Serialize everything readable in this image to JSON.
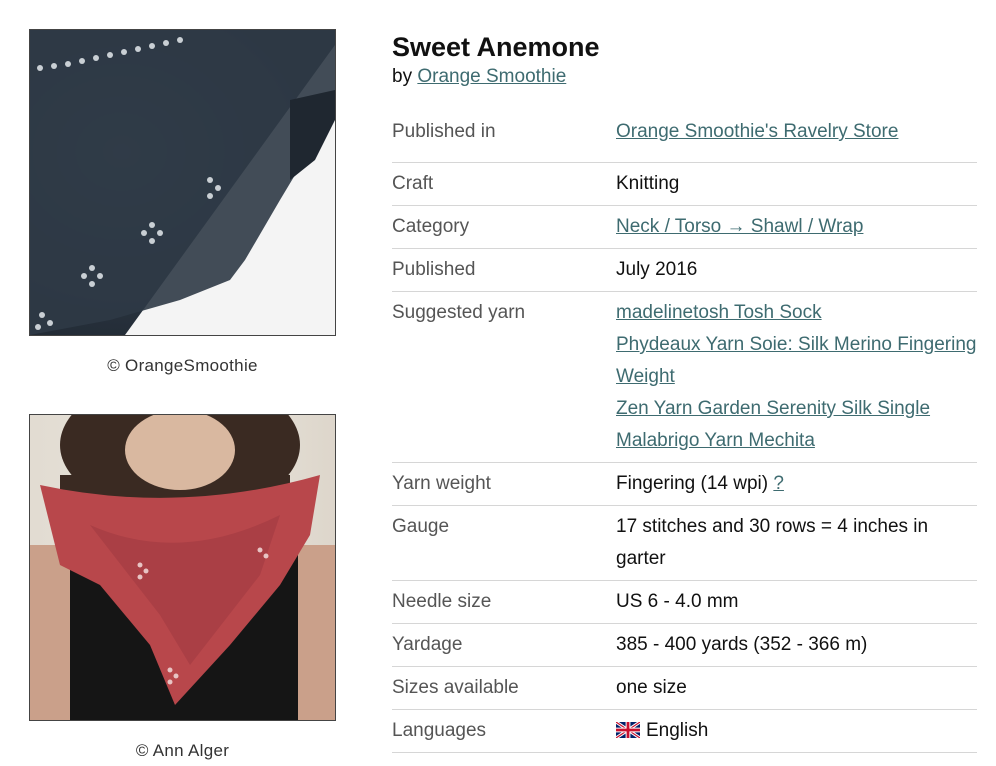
{
  "pattern": {
    "title": "Sweet Anemone",
    "by_prefix": "by",
    "designer": "Orange Smoothie"
  },
  "photos": [
    {
      "caption": "© OrangeSmoothie",
      "colors": [
        "#2b3642",
        "#f4f4f4"
      ]
    },
    {
      "caption": "© Ann Alger",
      "colors": [
        "#b4484c",
        "#161616",
        "#e6e0d6"
      ]
    }
  ],
  "details": {
    "published_in": {
      "label": "Published in",
      "value": "Orange Smoothie's Ravelry Store"
    },
    "craft": {
      "label": "Craft",
      "value": "Knitting"
    },
    "category": {
      "label": "Category",
      "value": "Neck / Torso → Shawl / Wrap"
    },
    "published": {
      "label": "Published",
      "value": "July 2016"
    },
    "suggested_yarn": {
      "label": "Suggested yarn",
      "items": [
        "madelinetosh Tosh Sock",
        "Phydeaux Yarn Soie: Silk Merino Fingering Weight",
        "Zen Yarn Garden Serenity Silk Single",
        "Malabrigo Yarn Mechita"
      ]
    },
    "yarn_weight": {
      "label": "Yarn weight",
      "value": "Fingering (14 wpi)",
      "help": "?"
    },
    "gauge": {
      "label": "Gauge",
      "value": "17 stitches and 30 rows = 4 inches in garter"
    },
    "needle_size": {
      "label": "Needle size",
      "value": "US 6 - 4.0 mm"
    },
    "yardage": {
      "label": "Yardage",
      "value": "385 - 400 yards (352 - 366 m)"
    },
    "sizes": {
      "label": "Sizes available",
      "value": "one size"
    },
    "languages": {
      "label": "Languages",
      "value": "English",
      "flag_icon": "uk-flag-icon"
    }
  },
  "theme": {
    "link_color": "#3e6b70",
    "label_color": "#555555",
    "divider": "#d6d6d6"
  }
}
